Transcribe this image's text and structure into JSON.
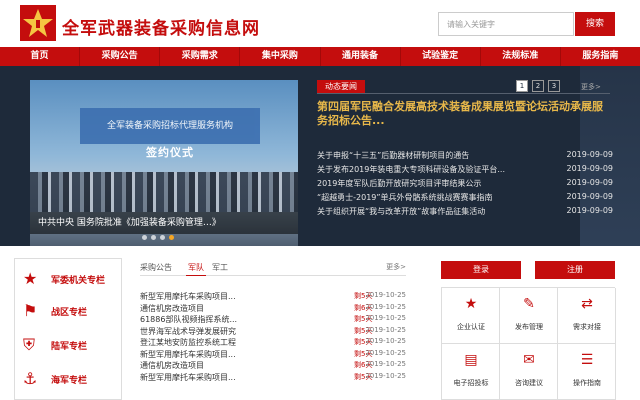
{
  "header": {
    "title": "全军武器装备采购信息网",
    "search_placeholder": "请输入关键字",
    "search_button": "搜索"
  },
  "nav": [
    "首页",
    "采购公告",
    "采购需求",
    "集中采购",
    "通用装备",
    "试验鉴定",
    "法规标准",
    "服务指南"
  ],
  "slider": {
    "banner_text": "全军装备采购招标代理服务机构",
    "sign_text": "签约仪式",
    "caption": "中共中央 国务院批准《加强装备采购管理…》"
  },
  "news": {
    "tab": "动态要闻",
    "pages": [
      "1",
      "2",
      "3"
    ],
    "more": "更多>",
    "headline": "第四届军民融合发展高技术装备成果展览暨论坛活动承展服务招标公告...",
    "items": [
      {
        "title": "关于申报“十三五”后勤器材研制项目的通告",
        "date": "2019-09-09"
      },
      {
        "title": "关于发布2019年装电重大专项科研设备及验证平台...",
        "date": "2019-09-09"
      },
      {
        "title": "2019年度军队后勤开放研究项目评审结果公示",
        "date": "2019-09-09"
      },
      {
        "title": "“超越勇士-2019”单兵外骨骼系统挑战赛赛事指南",
        "date": "2019-09-09"
      },
      {
        "title": "关于组织开展“我与改革开放”故事作品征集活动",
        "date": "2019-09-09"
      }
    ]
  },
  "sidebar": {
    "items": [
      {
        "icon": "star-icon",
        "label": "军委机关专栏"
      },
      {
        "icon": "flag-icon",
        "label": "战区专栏"
      },
      {
        "icon": "shield-icon",
        "label": "陆军专栏"
      },
      {
        "icon": "anchor-icon",
        "label": "海军专栏"
      }
    ]
  },
  "center": {
    "tabs": [
      "采购公告",
      "军队",
      "军工"
    ],
    "more": "更多>",
    "rows": [
      {
        "title": "新型军用摩托车采购项目...",
        "status": "剩5天",
        "date": "2019-10-25"
      },
      {
        "title": "通信机房改造项目",
        "status": "剩6天",
        "date": "2019-10-25"
      },
      {
        "title": "61886部队视频指挥系统...",
        "status": "剩5天",
        "date": "2019-10-25"
      },
      {
        "title": "世界海军战术导弹发展研究",
        "status": "剩5天",
        "date": "2019-10-25"
      },
      {
        "title": "登江某地安防监控系统工程",
        "status": "剩5天",
        "date": "2019-10-25"
      },
      {
        "title": "新型军用摩托车采购项目...",
        "status": "剩5天",
        "date": "2019-10-25"
      },
      {
        "title": "通信机房改造项目",
        "status": "剩6天",
        "date": "2019-10-25"
      },
      {
        "title": "新型军用摩托车采购项目...",
        "status": "剩5天",
        "date": "2019-10-25"
      }
    ]
  },
  "auth": {
    "login": "登录",
    "register": "注册",
    "services": [
      {
        "icon": "star-icon",
        "label": "企业认证"
      },
      {
        "icon": "edit-icon",
        "label": "发布管理"
      },
      {
        "icon": "connect-icon",
        "label": "需求对接"
      },
      {
        "icon": "doc-icon",
        "label": "电子招投标"
      },
      {
        "icon": "chat-icon",
        "label": "咨询建议"
      },
      {
        "icon": "guide-icon",
        "label": "操作指南"
      }
    ]
  },
  "colors": {
    "accent": "#c40d0d",
    "dark_band": "#1e2a3a",
    "headline": "#e8b84a"
  }
}
